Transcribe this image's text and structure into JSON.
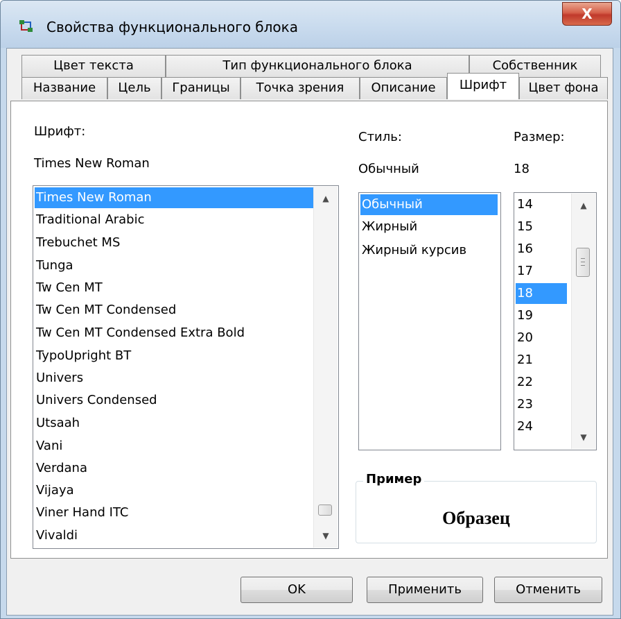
{
  "window": {
    "title": "Свойства функционального блока",
    "close_label": "X",
    "icon": "function-block-icon"
  },
  "tabs_back": [
    {
      "label": "Цвет текста"
    },
    {
      "label": "Тип функционального блока"
    },
    {
      "label": "Собственник"
    }
  ],
  "tabs_front": [
    {
      "label": "Название"
    },
    {
      "label": "Цель"
    },
    {
      "label": "Границы"
    },
    {
      "label": "Точка зрения"
    },
    {
      "label": "Описание"
    },
    {
      "label": "Шрифт",
      "active": true
    },
    {
      "label": "Цвет фона"
    }
  ],
  "font": {
    "label": "Шрифт:",
    "current": "Times New Roman",
    "list": [
      "Times New Roman",
      "Traditional Arabic",
      "Trebuchet MS",
      "Tunga",
      "Tw Cen MT",
      "Tw Cen MT Condensed",
      "Tw Cen MT Condensed Extra Bold",
      "TypoUpright BT",
      "Univers",
      "Univers Condensed",
      "Utsaah",
      "Vani",
      "Verdana",
      "Vijaya",
      "Viner Hand ITC",
      "Vivaldi"
    ],
    "selected_index": 0
  },
  "style": {
    "label": "Стиль:",
    "current": "Обычный",
    "list": [
      "Обычный",
      "Жирный",
      "Жирный курсив"
    ],
    "selected_index": 0
  },
  "size": {
    "label": "Размер:",
    "current": "18",
    "list": [
      "14",
      "15",
      "16",
      "17",
      "18",
      "19",
      "20",
      "21",
      "22",
      "23",
      "24"
    ],
    "selected_index": 4
  },
  "preview": {
    "title": "Пример",
    "sample": "Образец"
  },
  "buttons": {
    "ok": "OK",
    "apply": "Применить",
    "cancel": "Отменить"
  },
  "colors": {
    "selection": "#3399ff",
    "close_button": "#c0392b"
  }
}
